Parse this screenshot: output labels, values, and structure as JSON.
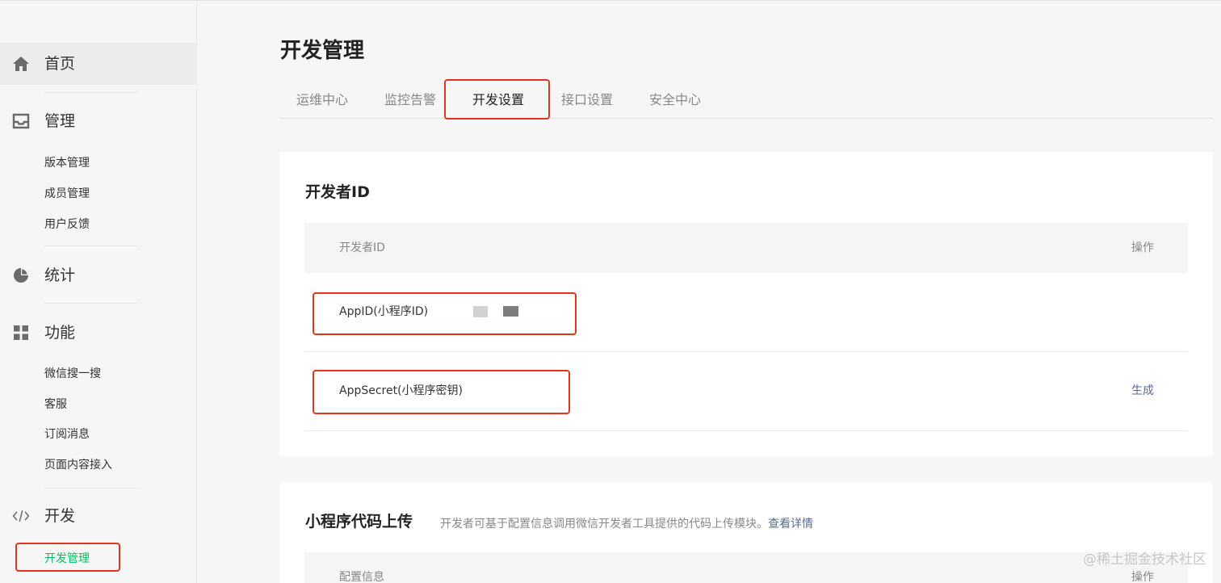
{
  "sidebar": {
    "sections": [
      {
        "label": "首页",
        "icon": "home-icon"
      },
      {
        "label": "管理",
        "icon": "inbox-icon",
        "items": [
          "版本管理",
          "成员管理",
          "用户反馈"
        ]
      },
      {
        "label": "统计",
        "icon": "pie-chart-icon"
      },
      {
        "label": "功能",
        "icon": "grid-icon",
        "items": [
          "微信搜一搜",
          "客服",
          "订阅消息",
          "页面内容接入"
        ]
      },
      {
        "label": "开发",
        "icon": "code-icon",
        "items": [
          "开发管理"
        ]
      }
    ],
    "active_section": "首页",
    "current_item": "开发管理"
  },
  "main": {
    "title": "开发管理",
    "tabs": [
      {
        "label": "运维中心"
      },
      {
        "label": "监控告警"
      },
      {
        "label": "开发设置"
      },
      {
        "label": "接口设置"
      },
      {
        "label": "安全中心"
      }
    ],
    "active_tab": "开发设置",
    "developer_id": {
      "title": "开发者ID",
      "columns": [
        "开发者ID",
        "操作"
      ],
      "rows": [
        {
          "key": "AppID(小程序ID)",
          "action": ""
        },
        {
          "key": "AppSecret(小程序密钥)",
          "action": "生成"
        }
      ]
    },
    "code_upload": {
      "title": "小程序代码上传",
      "description": "开发者可基于配置信息调用微信开发者工具提供的代码上传模块。",
      "link": "查看详情",
      "columns": [
        "配置信息",
        "操作"
      ]
    }
  },
  "watermark": "@稀土掘金技术社区",
  "colors": {
    "accent_green": "#07c160",
    "link_blue": "#576b95",
    "highlight_red": "#e0361f"
  }
}
